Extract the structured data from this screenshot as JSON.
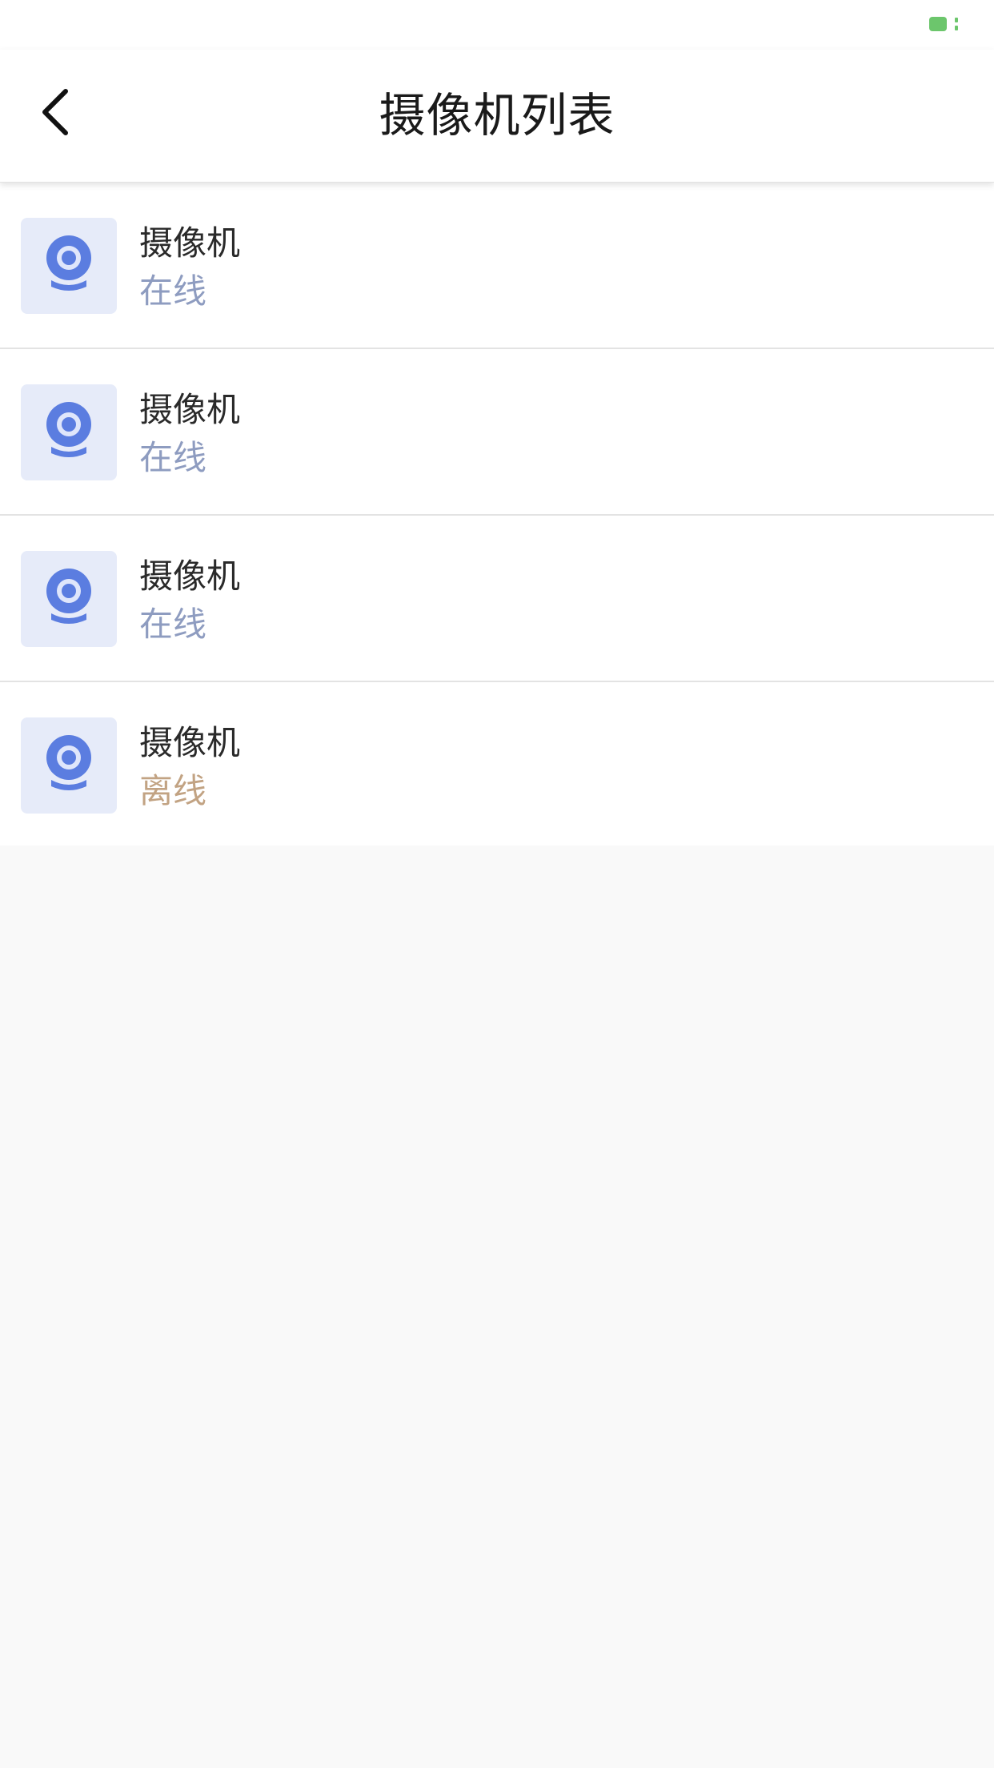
{
  "header": {
    "title": "摄像机列表"
  },
  "status_colors": {
    "online": "#8e9cc0",
    "offline": "#c2a383"
  },
  "accent_colors": {
    "battery": "#6cc66c",
    "camera_icon": "#5b7de0",
    "thumb_bg": "#e6ebf9"
  },
  "icons": {
    "back": "chevron-left-icon",
    "camera": "webcam-icon",
    "battery": "battery-icon"
  },
  "cameras": [
    {
      "name": "摄像机",
      "status": "在线",
      "state": "online"
    },
    {
      "name": "摄像机",
      "status": "在线",
      "state": "online"
    },
    {
      "name": "摄像机",
      "status": "在线",
      "state": "online"
    },
    {
      "name": "摄像机",
      "status": "离线",
      "state": "offline"
    }
  ]
}
